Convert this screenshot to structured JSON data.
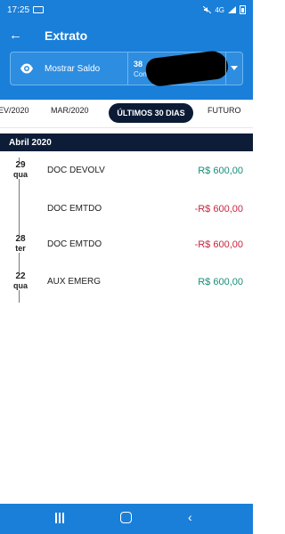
{
  "status": {
    "time": "17:25",
    "signal": "4G"
  },
  "header": {
    "title": "Extrato",
    "back_icon": "arrow-left-icon"
  },
  "balance": {
    "show_label": "Mostrar Saldo",
    "eye_icon": "eye-icon",
    "account_number_visible": "38",
    "account_type_visible": "Conta Su"
  },
  "tabs": [
    "EV/2020",
    "MAR/2020",
    "ÚLTIMOS 30 DIAS",
    "FUTURO"
  ],
  "active_tab": "ÚLTIMOS 30 DIAS",
  "month": "Abril 2020",
  "dates": [
    {
      "day": "29",
      "weekday": "qua"
    },
    {
      "day": "28",
      "weekday": "ter"
    },
    {
      "day": "22",
      "weekday": "qua"
    }
  ],
  "transactions": [
    {
      "description": "DOC DEVOLV",
      "amount": "R$ 600,00",
      "type": "credit"
    },
    {
      "description": "DOC EMTDO",
      "amount": "-R$ 600,00",
      "type": "debit"
    },
    {
      "description": "DOC EMTDO",
      "amount": "-R$ 600,00",
      "type": "debit"
    },
    {
      "description": "AUX EMERG",
      "amount": "R$ 600,00",
      "type": "credit"
    }
  ],
  "colors": {
    "primary": "#1a7fd9",
    "dark_navy": "#0d1d38",
    "credit": "#168d79",
    "debit": "#c9253f"
  },
  "nav": {
    "recent_icon": "recent-apps-icon",
    "home_icon": "home-icon",
    "back_icon": "back-icon"
  }
}
